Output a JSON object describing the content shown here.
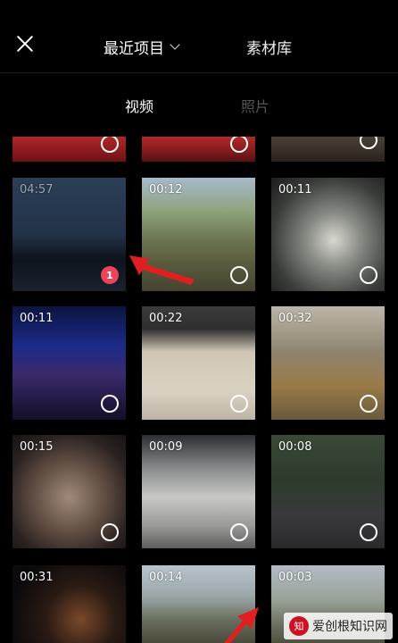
{
  "header": {
    "tab_recent": "最近项目",
    "tab_library": "素材库"
  },
  "subtabs": {
    "video": "视频",
    "photo": "照片"
  },
  "grid": {
    "row1": [
      {
        "duration": ""
      },
      {
        "duration": ""
      },
      {
        "duration": ""
      }
    ],
    "row2": [
      {
        "duration": "04:57",
        "selected_index": "1"
      },
      {
        "duration": "00:12"
      },
      {
        "duration": "00:11"
      }
    ],
    "row3": [
      {
        "duration": "00:11"
      },
      {
        "duration": "00:22"
      },
      {
        "duration": "00:32"
      }
    ],
    "row4": [
      {
        "duration": "00:15"
      },
      {
        "duration": "00:09"
      },
      {
        "duration": "00:08"
      }
    ],
    "row5": [
      {
        "duration": "00:31"
      },
      {
        "duration": "00:14"
      },
      {
        "duration": "00:03"
      }
    ]
  },
  "watermark": {
    "logo": "知",
    "text": "爱创根知识网"
  },
  "colors": {
    "background": "#000000",
    "badge": "#e8445a",
    "annotation_arrow": "#e02020"
  }
}
